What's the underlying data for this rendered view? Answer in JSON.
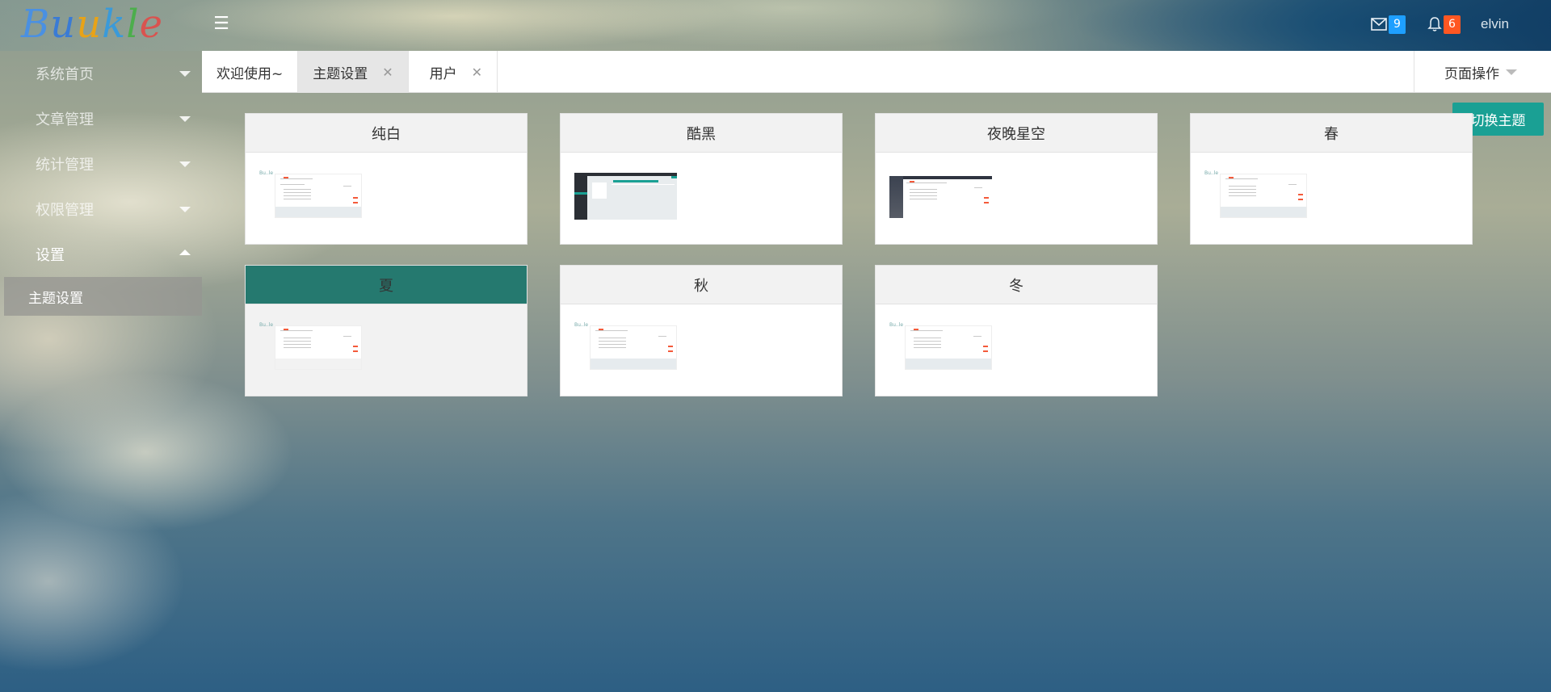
{
  "header": {
    "logo_letters": [
      "B",
      "u",
      "u",
      "k",
      "l",
      "e"
    ],
    "logo_colors": [
      "#4a90e2",
      "#3a7bd5",
      "#e8a317",
      "#3a9ad9",
      "#4cae4c",
      "#d9534f"
    ],
    "mail_count": "9",
    "mail_badge_color": "#1e9fff",
    "notice_count": "6",
    "notice_badge_color": "#ff5722",
    "user_name": "elvin"
  },
  "sidebar": {
    "items": [
      {
        "label": "系统首页"
      },
      {
        "label": "文章管理"
      },
      {
        "label": "统计管理"
      },
      {
        "label": "权限管理"
      },
      {
        "label": "设置"
      }
    ],
    "sub_items": [
      {
        "label": "主题设置"
      }
    ]
  },
  "tabs": [
    {
      "label": "欢迎使用~"
    },
    {
      "label": "主题设置"
    },
    {
      "label": "用户"
    }
  ],
  "page_ops_label": "页面操作",
  "switch_button_label": "切换主题",
  "themes": [
    {
      "name": "纯白"
    },
    {
      "name": "酷黑"
    },
    {
      "name": "夜晚星空"
    },
    {
      "name": "春"
    },
    {
      "name": "夏"
    },
    {
      "name": "秋"
    },
    {
      "name": "冬"
    }
  ],
  "colors": {
    "accent": "#1aa094",
    "selected_theme_header": "#25796f"
  }
}
